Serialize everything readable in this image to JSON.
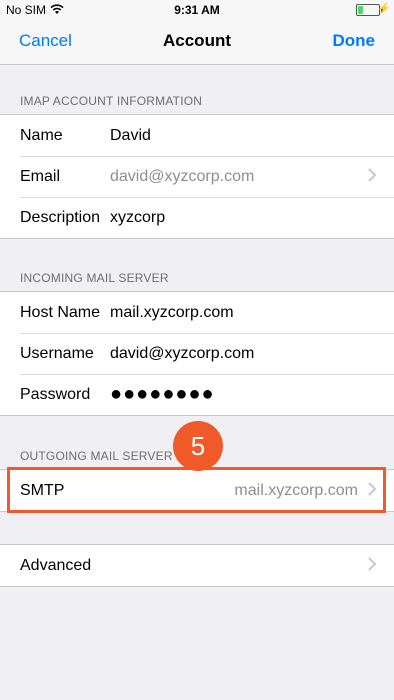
{
  "status_bar": {
    "carrier": "No SIM",
    "time": "9:31 AM",
    "battery_level": 0.25,
    "icons": [
      "wifi-icon",
      "battery-icon",
      "charging-icon"
    ]
  },
  "nav": {
    "cancel_label": "Cancel",
    "title": "Account",
    "done_label": "Done"
  },
  "imap_section": {
    "header": "IMAP ACCOUNT INFORMATION",
    "rows": [
      {
        "label": "Name",
        "value": "David"
      },
      {
        "label": "Email",
        "value": "david@xyzcorp.com"
      },
      {
        "label": "Description",
        "value": "xyzcorp"
      }
    ]
  },
  "incoming_section": {
    "header": "INCOMING MAIL SERVER",
    "rows": [
      {
        "label": "Host Name",
        "value": "mail.xyzcorp.com"
      },
      {
        "label": "Username",
        "value": "david@xyzcorp.com"
      },
      {
        "label": "Password",
        "value": "●●●●●●●●"
      }
    ]
  },
  "outgoing_section": {
    "header": "OUTGOING MAIL SERVER",
    "smtp_label": "SMTP",
    "smtp_value": "mail.xyzcorp.com"
  },
  "advanced_label": "Advanced",
  "annotation": {
    "step_number": "5",
    "color": "#f05a28"
  },
  "colors": {
    "accent": "#007aff",
    "background": "#efeff4"
  }
}
